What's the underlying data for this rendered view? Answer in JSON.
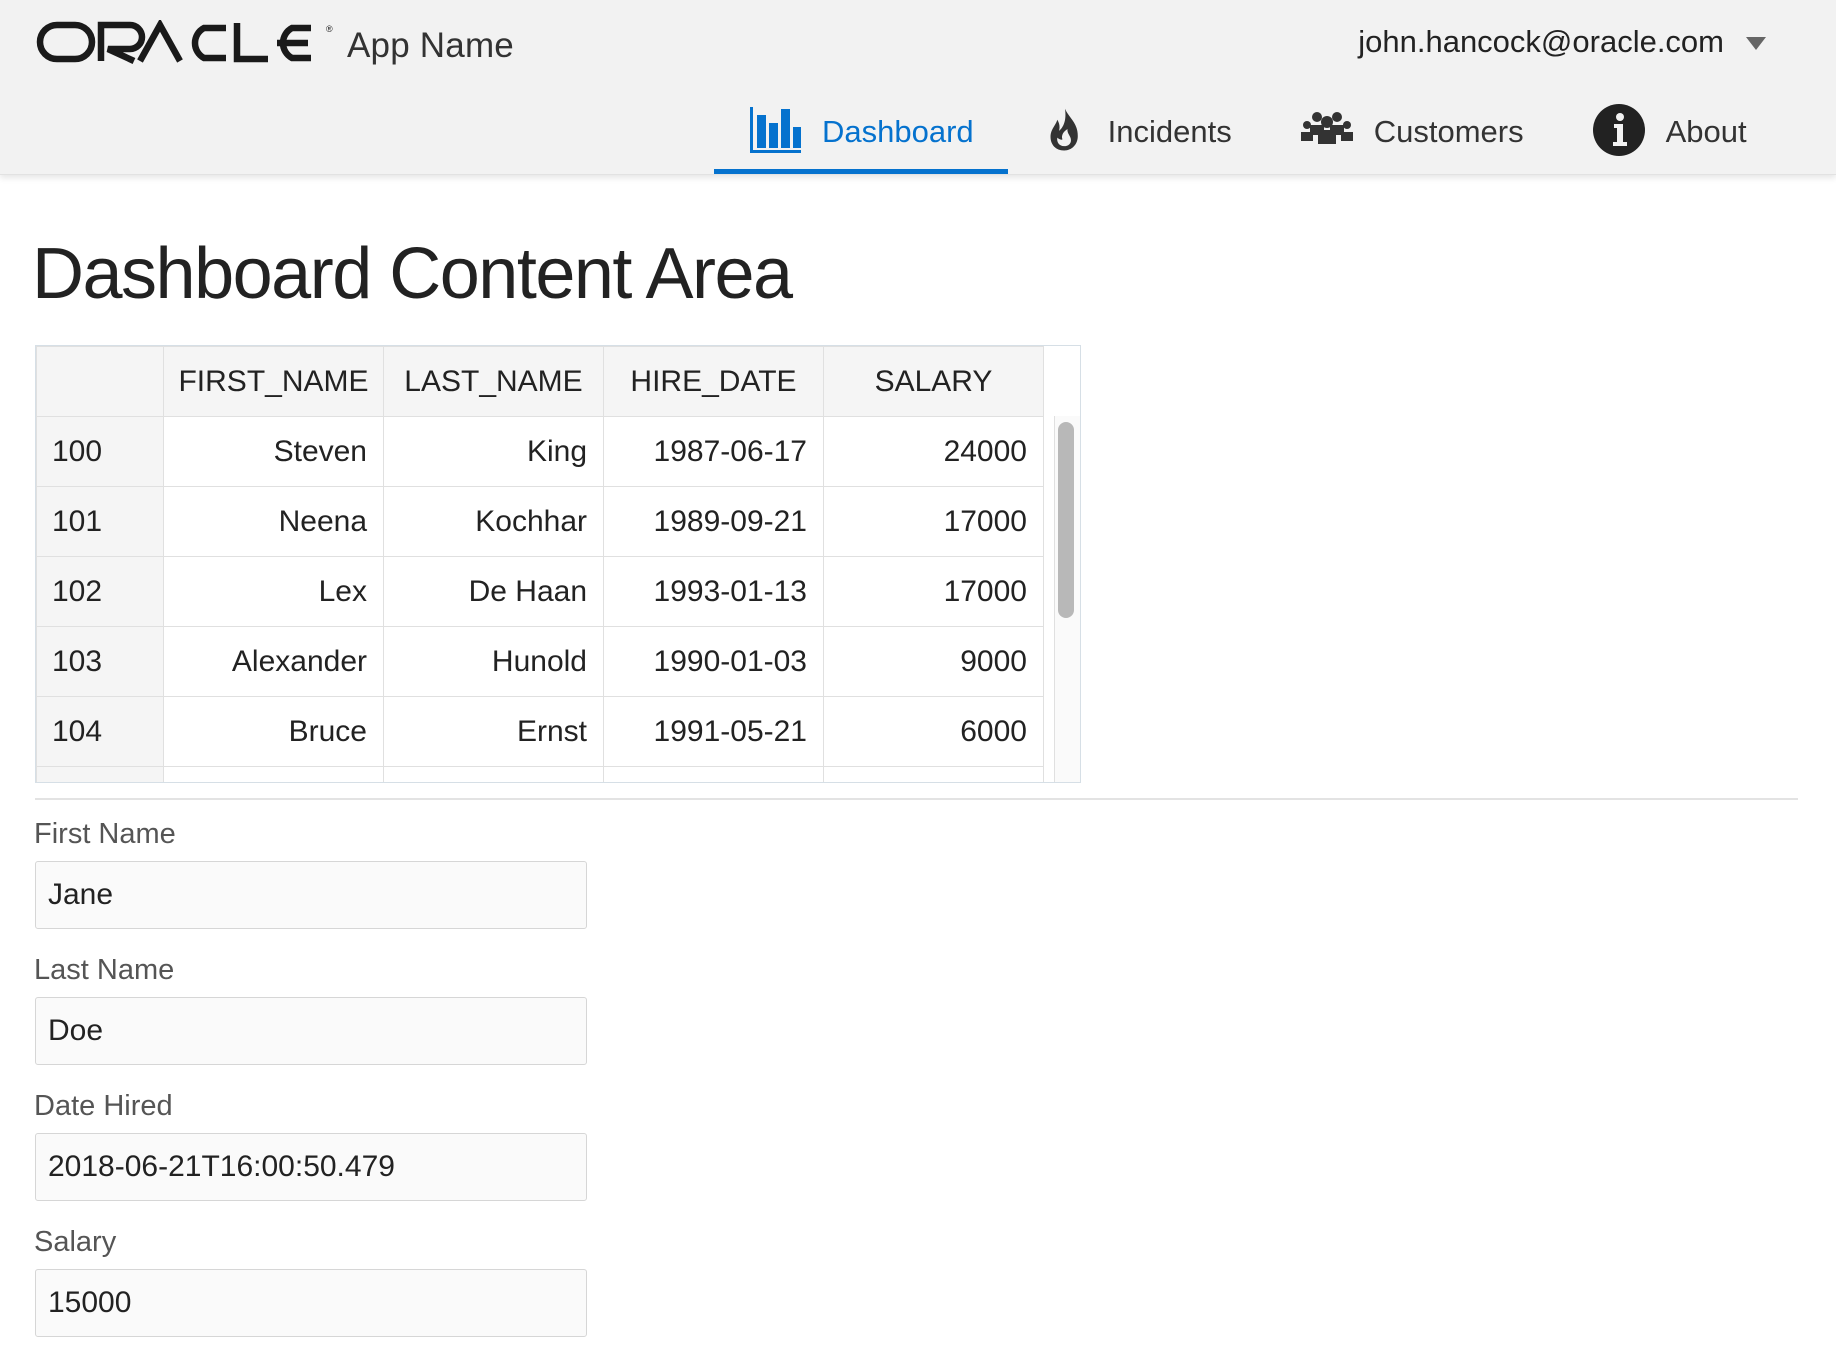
{
  "header": {
    "logo_text": "ORACLE",
    "app_name": "App Name",
    "user_email": "john.hancock@oracle.com"
  },
  "nav": {
    "items": [
      {
        "label": "Dashboard",
        "icon": "bar-chart-icon",
        "selected": true
      },
      {
        "label": "Incidents",
        "icon": "fire-icon",
        "selected": false
      },
      {
        "label": "Customers",
        "icon": "people-icon",
        "selected": false
      },
      {
        "label": "About",
        "icon": "info-icon",
        "selected": false
      }
    ],
    "accent_color": "#0572ce"
  },
  "main": {
    "title": "Dashboard Content Area",
    "table": {
      "columns": [
        "",
        "FIRST_NAME",
        "LAST_NAME",
        "HIRE_DATE",
        "SALARY"
      ],
      "rows": [
        [
          "100",
          "Steven",
          "King",
          "1987-06-17",
          "24000"
        ],
        [
          "101",
          "Neena",
          "Kochhar",
          "1989-09-21",
          "17000"
        ],
        [
          "102",
          "Lex",
          "De Haan",
          "1993-01-13",
          "17000"
        ],
        [
          "103",
          "Alexander",
          "Hunold",
          "1990-01-03",
          "9000"
        ],
        [
          "104",
          "Bruce",
          "Ernst",
          "1991-05-21",
          "6000"
        ]
      ]
    },
    "form": {
      "first_name": {
        "label": "First Name",
        "value": "Jane"
      },
      "last_name": {
        "label": "Last Name",
        "value": "Doe"
      },
      "date_hired": {
        "label": "Date Hired",
        "value": "2018-06-21T16:00:50.479"
      },
      "salary": {
        "label": "Salary",
        "value": "15000"
      }
    }
  }
}
